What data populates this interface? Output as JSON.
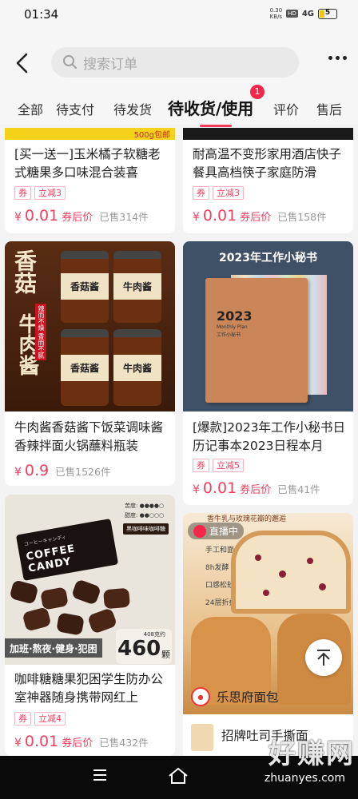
{
  "status": {
    "time": "01:34",
    "speed_value": "0.30",
    "speed_unit": "KB/s",
    "hd": "HD",
    "signal": "4G",
    "battery": "5"
  },
  "header": {
    "search_placeholder": "搜索订单",
    "tabs": [
      "全部",
      "待支付",
      "待发货",
      "待收货/使用",
      "评价",
      "售后"
    ],
    "active_tab": "待收货/使用",
    "badge_count": "1"
  },
  "products": [
    {
      "title": "[买一送一]玉米橘子软糖老式糖果多口味混合装喜",
      "tags": [
        "券",
        "立减3"
      ],
      "currency": "¥",
      "price": "0.01",
      "after_coupon": "券后价",
      "sold": "已售314件",
      "banner_text": "500g包邮"
    },
    {
      "title": "耐高温不变形家用酒店快子餐具高档筷子家庭防滑",
      "tags": [
        "券",
        "立减3"
      ],
      "currency": "¥",
      "price": "0.01",
      "after_coupon": "券后价",
      "sold": "已售158件"
    },
    {
      "title": "牛肉酱香菇酱下饭菜调味酱香辣拌面火锅蘸料瓶装",
      "tags": [],
      "currency": "¥",
      "price": "0.9",
      "after_coupon": "",
      "sold": "已售1526件",
      "image_text": {
        "big1": "香菇",
        "big2": "牛肉酱",
        "small": "辣而不燥 香而不腻",
        "jar1": "香菇酱",
        "jar2": "牛肉酱"
      }
    },
    {
      "title": "[爆款]2023年工作小秘书日历记事本2023日程本月",
      "tags": [
        "券",
        "立减5"
      ],
      "currency": "¥",
      "price": "0.01",
      "after_coupon": "券后价",
      "sold": "已售41件",
      "image_text": {
        "headline": "2023年工作小秘书",
        "book_year": "2023",
        "book_sub": "Monthly Plan",
        "book_cn": "工作小秘书"
      }
    },
    {
      "title": "咖啡糖糖果犯困学生防办公室神器随身携带网红上",
      "tags": [
        "券",
        "立减4"
      ],
      "currency": "¥",
      "price": "0.01",
      "after_coupon": "券后价",
      "sold": "已售432件",
      "image_text": {
        "candy": "COFFEE CANDY",
        "candy_jp": "コーヒーキャンディ",
        "flavor": "黑咖啡味咖啡糖",
        "rating1": "苦度:",
        "rating2": "甜度:",
        "slogan": "加班·熬夜·健身·犯困",
        "count_note": "408克约",
        "count": "460",
        "count_unit": "颗"
      }
    },
    {
      "title": "招牌吐司手撕面",
      "live": "直播中",
      "shop": "乐思府面包",
      "image_text": {
        "headline": "香牛乳与玫瑰花瓣的邂逅",
        "f1": "手工和面",
        "f2": "8h发酵",
        "f3": "口感松软",
        "f4": "24层折叠"
      }
    }
  ],
  "watermark": {
    "main": "好赚网",
    "sub": "zhuanyes.com"
  }
}
